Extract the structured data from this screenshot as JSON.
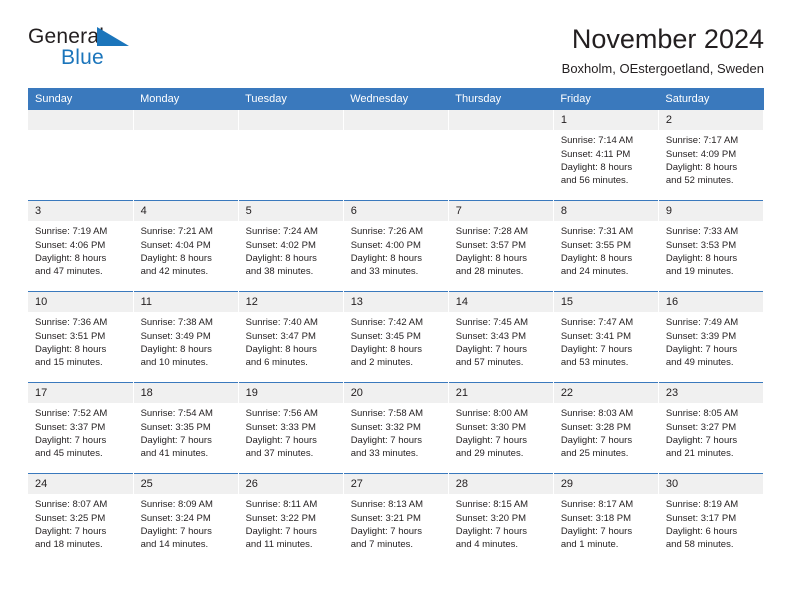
{
  "logo": {
    "general_text": "General",
    "blue_text": "Blue",
    "triangle_color": "#1b75bb"
  },
  "header": {
    "title": "November 2024",
    "subtitle": "Boxholm, OEstergoetland, Sweden"
  },
  "theme": {
    "header_band": "#3a79bd",
    "daynum_band": "#f0f0f0",
    "text": "#231f20",
    "accent": "#1b75bb"
  },
  "weekday_headers": [
    "Sunday",
    "Monday",
    "Tuesday",
    "Wednesday",
    "Thursday",
    "Friday",
    "Saturday"
  ],
  "weeks": [
    [
      {
        "day": "",
        "sunrise": "",
        "sunset": "",
        "daylight_line1": "",
        "daylight_line2": ""
      },
      {
        "day": "",
        "sunrise": "",
        "sunset": "",
        "daylight_line1": "",
        "daylight_line2": ""
      },
      {
        "day": "",
        "sunrise": "",
        "sunset": "",
        "daylight_line1": "",
        "daylight_line2": ""
      },
      {
        "day": "",
        "sunrise": "",
        "sunset": "",
        "daylight_line1": "",
        "daylight_line2": ""
      },
      {
        "day": "",
        "sunrise": "",
        "sunset": "",
        "daylight_line1": "",
        "daylight_line2": ""
      },
      {
        "day": "1",
        "sunrise": "Sunrise: 7:14 AM",
        "sunset": "Sunset: 4:11 PM",
        "daylight_line1": "Daylight: 8 hours",
        "daylight_line2": "and 56 minutes."
      },
      {
        "day": "2",
        "sunrise": "Sunrise: 7:17 AM",
        "sunset": "Sunset: 4:09 PM",
        "daylight_line1": "Daylight: 8 hours",
        "daylight_line2": "and 52 minutes."
      }
    ],
    [
      {
        "day": "3",
        "sunrise": "Sunrise: 7:19 AM",
        "sunset": "Sunset: 4:06 PM",
        "daylight_line1": "Daylight: 8 hours",
        "daylight_line2": "and 47 minutes."
      },
      {
        "day": "4",
        "sunrise": "Sunrise: 7:21 AM",
        "sunset": "Sunset: 4:04 PM",
        "daylight_line1": "Daylight: 8 hours",
        "daylight_line2": "and 42 minutes."
      },
      {
        "day": "5",
        "sunrise": "Sunrise: 7:24 AM",
        "sunset": "Sunset: 4:02 PM",
        "daylight_line1": "Daylight: 8 hours",
        "daylight_line2": "and 38 minutes."
      },
      {
        "day": "6",
        "sunrise": "Sunrise: 7:26 AM",
        "sunset": "Sunset: 4:00 PM",
        "daylight_line1": "Daylight: 8 hours",
        "daylight_line2": "and 33 minutes."
      },
      {
        "day": "7",
        "sunrise": "Sunrise: 7:28 AM",
        "sunset": "Sunset: 3:57 PM",
        "daylight_line1": "Daylight: 8 hours",
        "daylight_line2": "and 28 minutes."
      },
      {
        "day": "8",
        "sunrise": "Sunrise: 7:31 AM",
        "sunset": "Sunset: 3:55 PM",
        "daylight_line1": "Daylight: 8 hours",
        "daylight_line2": "and 24 minutes."
      },
      {
        "day": "9",
        "sunrise": "Sunrise: 7:33 AM",
        "sunset": "Sunset: 3:53 PM",
        "daylight_line1": "Daylight: 8 hours",
        "daylight_line2": "and 19 minutes."
      }
    ],
    [
      {
        "day": "10",
        "sunrise": "Sunrise: 7:36 AM",
        "sunset": "Sunset: 3:51 PM",
        "daylight_line1": "Daylight: 8 hours",
        "daylight_line2": "and 15 minutes."
      },
      {
        "day": "11",
        "sunrise": "Sunrise: 7:38 AM",
        "sunset": "Sunset: 3:49 PM",
        "daylight_line1": "Daylight: 8 hours",
        "daylight_line2": "and 10 minutes."
      },
      {
        "day": "12",
        "sunrise": "Sunrise: 7:40 AM",
        "sunset": "Sunset: 3:47 PM",
        "daylight_line1": "Daylight: 8 hours",
        "daylight_line2": "and 6 minutes."
      },
      {
        "day": "13",
        "sunrise": "Sunrise: 7:42 AM",
        "sunset": "Sunset: 3:45 PM",
        "daylight_line1": "Daylight: 8 hours",
        "daylight_line2": "and 2 minutes."
      },
      {
        "day": "14",
        "sunrise": "Sunrise: 7:45 AM",
        "sunset": "Sunset: 3:43 PM",
        "daylight_line1": "Daylight: 7 hours",
        "daylight_line2": "and 57 minutes."
      },
      {
        "day": "15",
        "sunrise": "Sunrise: 7:47 AM",
        "sunset": "Sunset: 3:41 PM",
        "daylight_line1": "Daylight: 7 hours",
        "daylight_line2": "and 53 minutes."
      },
      {
        "day": "16",
        "sunrise": "Sunrise: 7:49 AM",
        "sunset": "Sunset: 3:39 PM",
        "daylight_line1": "Daylight: 7 hours",
        "daylight_line2": "and 49 minutes."
      }
    ],
    [
      {
        "day": "17",
        "sunrise": "Sunrise: 7:52 AM",
        "sunset": "Sunset: 3:37 PM",
        "daylight_line1": "Daylight: 7 hours",
        "daylight_line2": "and 45 minutes."
      },
      {
        "day": "18",
        "sunrise": "Sunrise: 7:54 AM",
        "sunset": "Sunset: 3:35 PM",
        "daylight_line1": "Daylight: 7 hours",
        "daylight_line2": "and 41 minutes."
      },
      {
        "day": "19",
        "sunrise": "Sunrise: 7:56 AM",
        "sunset": "Sunset: 3:33 PM",
        "daylight_line1": "Daylight: 7 hours",
        "daylight_line2": "and 37 minutes."
      },
      {
        "day": "20",
        "sunrise": "Sunrise: 7:58 AM",
        "sunset": "Sunset: 3:32 PM",
        "daylight_line1": "Daylight: 7 hours",
        "daylight_line2": "and 33 minutes."
      },
      {
        "day": "21",
        "sunrise": "Sunrise: 8:00 AM",
        "sunset": "Sunset: 3:30 PM",
        "daylight_line1": "Daylight: 7 hours",
        "daylight_line2": "and 29 minutes."
      },
      {
        "day": "22",
        "sunrise": "Sunrise: 8:03 AM",
        "sunset": "Sunset: 3:28 PM",
        "daylight_line1": "Daylight: 7 hours",
        "daylight_line2": "and 25 minutes."
      },
      {
        "day": "23",
        "sunrise": "Sunrise: 8:05 AM",
        "sunset": "Sunset: 3:27 PM",
        "daylight_line1": "Daylight: 7 hours",
        "daylight_line2": "and 21 minutes."
      }
    ],
    [
      {
        "day": "24",
        "sunrise": "Sunrise: 8:07 AM",
        "sunset": "Sunset: 3:25 PM",
        "daylight_line1": "Daylight: 7 hours",
        "daylight_line2": "and 18 minutes."
      },
      {
        "day": "25",
        "sunrise": "Sunrise: 8:09 AM",
        "sunset": "Sunset: 3:24 PM",
        "daylight_line1": "Daylight: 7 hours",
        "daylight_line2": "and 14 minutes."
      },
      {
        "day": "26",
        "sunrise": "Sunrise: 8:11 AM",
        "sunset": "Sunset: 3:22 PM",
        "daylight_line1": "Daylight: 7 hours",
        "daylight_line2": "and 11 minutes."
      },
      {
        "day": "27",
        "sunrise": "Sunrise: 8:13 AM",
        "sunset": "Sunset: 3:21 PM",
        "daylight_line1": "Daylight: 7 hours",
        "daylight_line2": "and 7 minutes."
      },
      {
        "day": "28",
        "sunrise": "Sunrise: 8:15 AM",
        "sunset": "Sunset: 3:20 PM",
        "daylight_line1": "Daylight: 7 hours",
        "daylight_line2": "and 4 minutes."
      },
      {
        "day": "29",
        "sunrise": "Sunrise: 8:17 AM",
        "sunset": "Sunset: 3:18 PM",
        "daylight_line1": "Daylight: 7 hours",
        "daylight_line2": "and 1 minute."
      },
      {
        "day": "30",
        "sunrise": "Sunrise: 8:19 AM",
        "sunset": "Sunset: 3:17 PM",
        "daylight_line1": "Daylight: 6 hours",
        "daylight_line2": "and 58 minutes."
      }
    ]
  ]
}
